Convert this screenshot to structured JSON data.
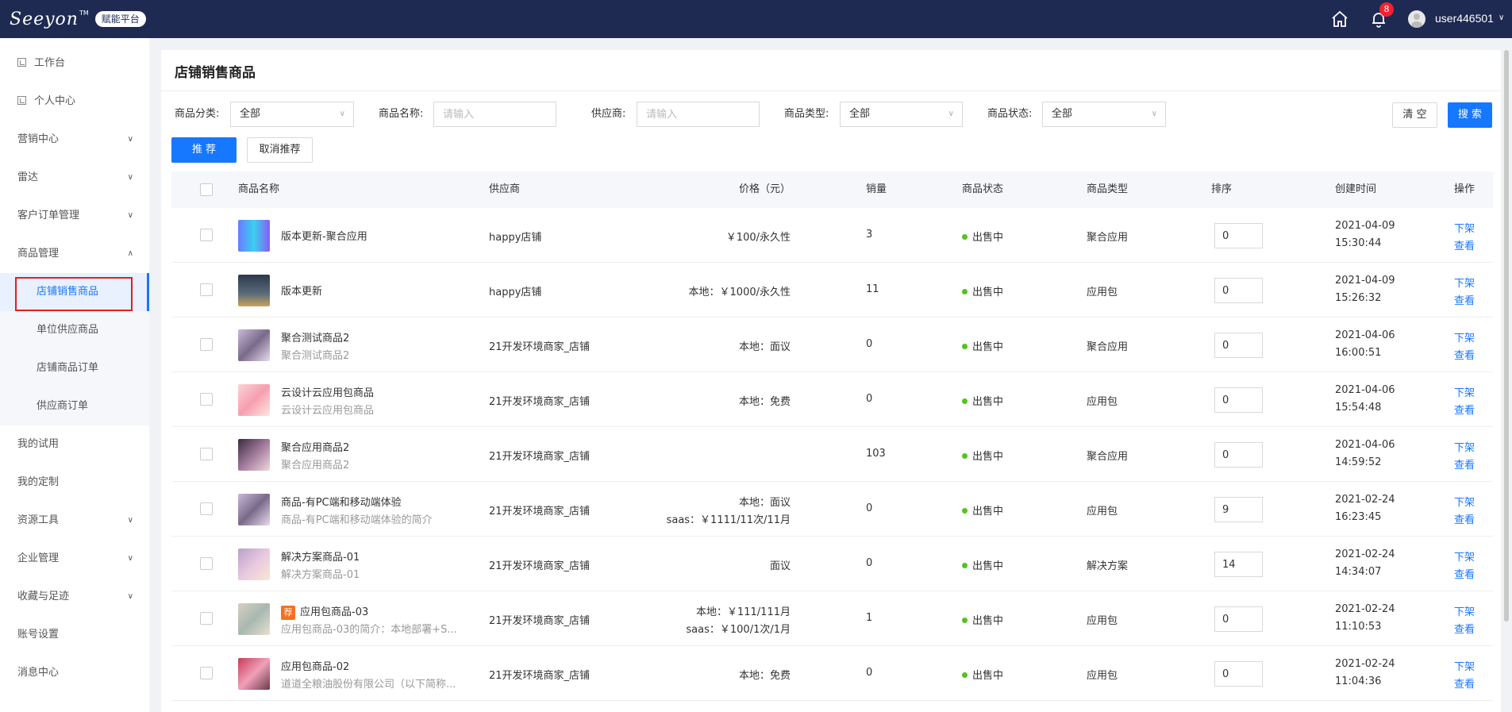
{
  "header": {
    "logo_text": "Seeyon",
    "logo_tm": "TM",
    "platform_badge": "赋能平台",
    "notification_count": "8",
    "username": "user446501"
  },
  "sidebar": {
    "items": [
      {
        "label": "工作台"
      },
      {
        "label": "个人中心"
      },
      {
        "label": "营销中心"
      },
      {
        "label": "雷达"
      },
      {
        "label": "客户订单管理"
      },
      {
        "label": "商品管理"
      },
      {
        "label": "我的试用"
      },
      {
        "label": "我的定制"
      },
      {
        "label": "资源工具"
      },
      {
        "label": "企业管理"
      },
      {
        "label": "收藏与足迹"
      },
      {
        "label": "账号设置"
      },
      {
        "label": "消息中心"
      }
    ],
    "sub_items": [
      {
        "label": "店铺销售商品"
      },
      {
        "label": "单位供应商品"
      },
      {
        "label": "店铺商品订单"
      },
      {
        "label": "供应商订单"
      }
    ]
  },
  "main": {
    "title": "店铺销售商品",
    "filters": {
      "category_label": "商品分类:",
      "category_value": "全部",
      "name_label": "商品名称:",
      "name_placeholder": "请输入",
      "supplier_label": "供应商:",
      "supplier_placeholder": "请输入",
      "type_label": "商品类型:",
      "type_value": "全部",
      "status_label": "商品状态:",
      "status_value": "全部",
      "clear_label": "清 空",
      "search_label": "搜 索"
    },
    "actions": {
      "recommend_label": "推 荐",
      "cancel_recommend_label": "取消推荐"
    },
    "table": {
      "columns": [
        "商品名称",
        "供应商",
        "价格（元）",
        "销量",
        "商品状态",
        "商品类型",
        "排序",
        "创建时间",
        "操作"
      ],
      "rows": [
        {
          "name": "版本更新-聚合应用",
          "desc": "",
          "rec": "",
          "supplier": "happy店铺",
          "price1": "￥100/永久性",
          "price2": "",
          "sales": "3",
          "status": "出售中",
          "type": "聚合应用",
          "sort": "0",
          "date": "2021-04-09",
          "time": "15:30:44",
          "action1": "下架",
          "action2": "查看"
        },
        {
          "name": "版本更新",
          "desc": "",
          "rec": "",
          "supplier": "happy店铺",
          "price1": "本地：￥1000/永久性",
          "price2": "",
          "sales": "11",
          "status": "出售中",
          "type": "应用包",
          "sort": "0",
          "date": "2021-04-09",
          "time": "15:26:32",
          "action1": "下架",
          "action2": "查看"
        },
        {
          "name": "聚合测试商品2",
          "desc": "聚合测试商品2",
          "rec": "",
          "supplier": "21开发环境商家_店铺",
          "price1": "本地：面议",
          "price2": "",
          "sales": "0",
          "status": "出售中",
          "type": "聚合应用",
          "sort": "0",
          "date": "2021-04-06",
          "time": "16:00:51",
          "action1": "下架",
          "action2": "查看"
        },
        {
          "name": "云设计云应用包商品",
          "desc": "云设计云应用包商品",
          "rec": "",
          "supplier": "21开发环境商家_店铺",
          "price1": "本地：免费",
          "price2": "",
          "sales": "0",
          "status": "出售中",
          "type": "应用包",
          "sort": "0",
          "date": "2021-04-06",
          "time": "15:54:48",
          "action1": "下架",
          "action2": "查看"
        },
        {
          "name": "聚合应用商品2",
          "desc": "聚合应用商品2",
          "rec": "",
          "supplier": "21开发环境商家_店铺",
          "price1": "",
          "price2": "",
          "sales": "103",
          "status": "出售中",
          "type": "聚合应用",
          "sort": "0",
          "date": "2021-04-06",
          "time": "14:59:52",
          "action1": "下架",
          "action2": "查看"
        },
        {
          "name": "商品-有PC端和移动端体验",
          "desc": "商品-有PC端和移动端体验的简介",
          "rec": "",
          "supplier": "21开发环境商家_店铺",
          "price1": "本地：面议",
          "price2": "saas：￥1111/11次/11月",
          "sales": "0",
          "status": "出售中",
          "type": "应用包",
          "sort": "9",
          "date": "2021-02-24",
          "time": "16:23:45",
          "action1": "下架",
          "action2": "查看"
        },
        {
          "name": "解决方案商品-01",
          "desc": "解决方案商品-01",
          "rec": "",
          "supplier": "21开发环境商家_店铺",
          "price1": "面议",
          "price2": "",
          "sales": "0",
          "status": "出售中",
          "type": "解决方案",
          "sort": "14",
          "date": "2021-02-24",
          "time": "14:34:07",
          "action1": "下架",
          "action2": "查看"
        },
        {
          "name": "应用包商品-03",
          "desc": "应用包商品-03的简介：本地部署+S...",
          "rec": "荐",
          "supplier": "21开发环境商家_店铺",
          "price1": "本地：￥111/111月",
          "price2": "saas：￥100/1次/1月",
          "sales": "1",
          "status": "出售中",
          "type": "应用包",
          "sort": "0",
          "date": "2021-02-24",
          "time": "11:10:53",
          "action1": "下架",
          "action2": "查看"
        },
        {
          "name": "应用包商品-02",
          "desc": "道道全粮油股份有限公司（以下简称...",
          "rec": "",
          "supplier": "21开发环境商家_店铺",
          "price1": "本地：免费",
          "price2": "",
          "sales": "0",
          "status": "出售中",
          "type": "应用包",
          "sort": "0",
          "date": "2021-02-24",
          "time": "11:04:36",
          "action1": "下架",
          "action2": "查看"
        }
      ]
    }
  },
  "colors": {
    "topbar": "#1e2a52",
    "primary": "#1677ff",
    "status_green": "#52c41a",
    "highlight_red": "#e02020"
  }
}
